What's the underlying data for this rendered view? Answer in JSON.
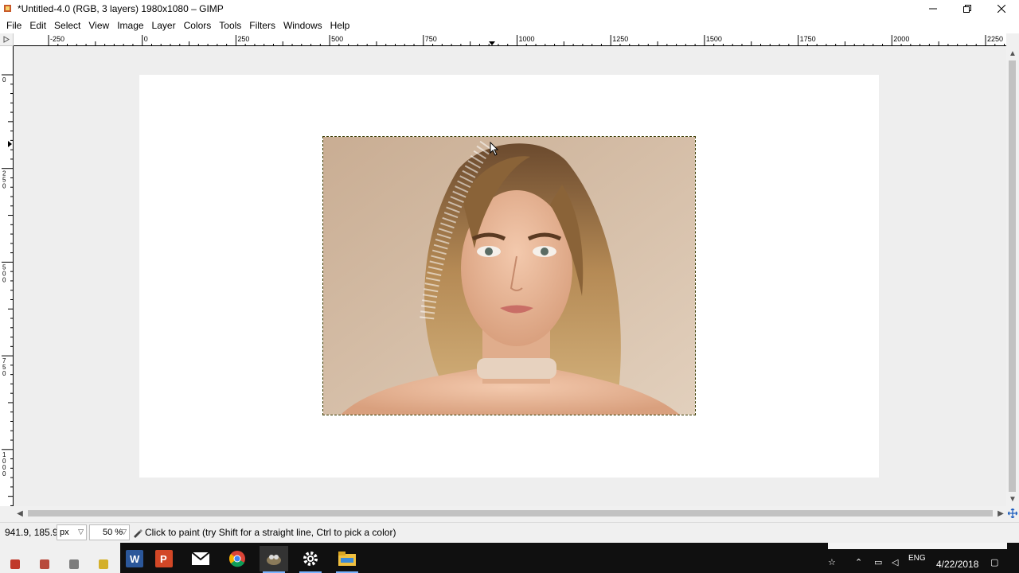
{
  "window": {
    "title": "*Untitled-4.0 (RGB, 3 layers) 1980x1080 – GIMP",
    "min_icon": "minimize-icon",
    "max_icon": "restore-icon",
    "close_icon": "close-icon"
  },
  "menubar": {
    "items": [
      {
        "label": "File"
      },
      {
        "label": "Edit"
      },
      {
        "label": "Select"
      },
      {
        "label": "View"
      },
      {
        "label": "Image"
      },
      {
        "label": "Layer"
      },
      {
        "label": "Colors"
      },
      {
        "label": "Tools"
      },
      {
        "label": "Filters"
      },
      {
        "label": "Windows"
      },
      {
        "label": "Help"
      }
    ]
  },
  "rulers": {
    "horizontal_ticks": [
      "-250",
      "0",
      "250",
      "500",
      "750",
      "1000",
      "1250",
      "1500",
      "1750",
      "2000",
      "2250"
    ],
    "vertical_ticks": [
      "0",
      "250",
      "500",
      "750",
      "1000"
    ]
  },
  "statusbar": {
    "coords": "941.9, 185.9",
    "unit": "px",
    "zoom": "50 %",
    "message": "Click to paint (try Shift for a straight line, Ctrl to pick a color)"
  },
  "taskbar": {
    "apps": [
      "word-icon",
      "powerpoint-icon",
      "mail-icon",
      "chrome-icon",
      "gimp-icon",
      "settings-icon",
      "file-explorer-icon"
    ],
    "language": "ENG",
    "date": "4/22/2018"
  },
  "colors": {
    "accent": "#7ab4ff",
    "canvas_bg": "#eeeeee",
    "taskbar": "#101010"
  }
}
